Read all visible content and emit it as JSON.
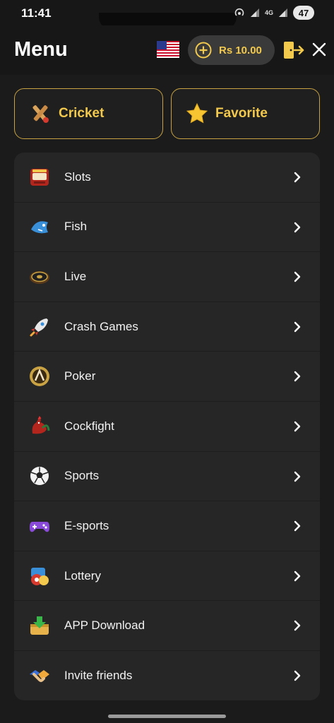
{
  "status_bar": {
    "time": "11:41",
    "network": "4G",
    "battery": "47"
  },
  "header": {
    "title": "Menu",
    "flag_icon": "us-flag-icon",
    "balance": "Rs 10.00",
    "add_icon": "plus-circle-icon",
    "exit_icon": "logout-icon",
    "close_icon": "close-icon"
  },
  "quick_buttons": [
    {
      "label": "Cricket",
      "icon": "cricket-bat-icon"
    },
    {
      "label": "Favorite",
      "icon": "star-icon"
    }
  ],
  "menu_items": [
    {
      "label": "Slots",
      "icon": "slot-machine-icon"
    },
    {
      "label": "Fish",
      "icon": "fish-icon"
    },
    {
      "label": "Live",
      "icon": "roulette-icon"
    },
    {
      "label": "Crash Games",
      "icon": "rocket-icon"
    },
    {
      "label": "Poker",
      "icon": "poker-icon"
    },
    {
      "label": "Cockfight",
      "icon": "rooster-icon"
    },
    {
      "label": "Sports",
      "icon": "soccer-ball-icon"
    },
    {
      "label": "E-sports",
      "icon": "gamepad-icon"
    },
    {
      "label": "Lottery",
      "icon": "lottery-balls-icon"
    },
    {
      "label": "APP Download",
      "icon": "download-icon"
    },
    {
      "label": "Invite friends",
      "icon": "handshake-icon"
    }
  ],
  "colors": {
    "accent": "#f2c94c",
    "border_gold": "#c8a243",
    "background": "#1b1b1b",
    "panel": "#262626"
  }
}
